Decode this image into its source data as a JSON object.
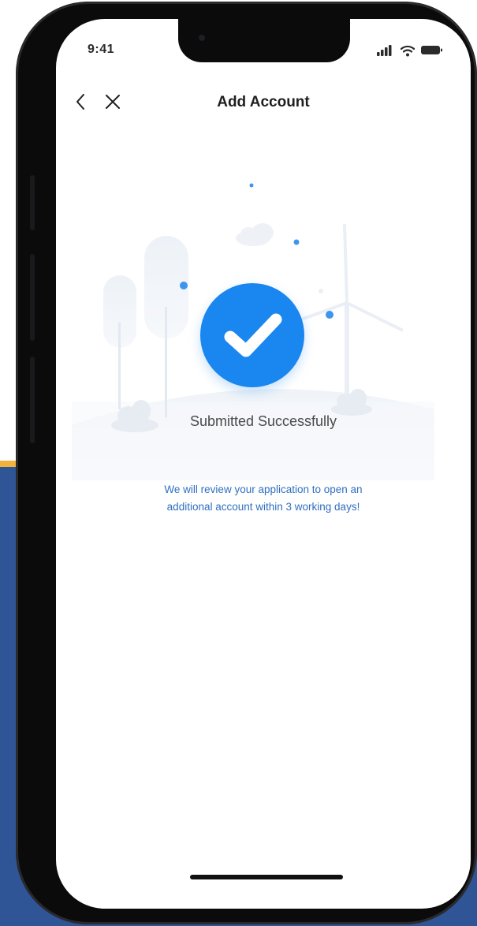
{
  "status_bar": {
    "time": "9:41"
  },
  "nav": {
    "title": "Add Account",
    "back_icon": "chevron-left-icon",
    "close_icon": "close-icon"
  },
  "result": {
    "title": "Submitted Successfully",
    "message": "We will review your application to open an additional account within 3 working days!",
    "icon": "checkmark-icon",
    "accent_color": "#1a86ef",
    "message_color": "#2f6fc0"
  },
  "backdrop": {
    "band_color": "#f2b33d",
    "panel_color": "#2f5597"
  }
}
